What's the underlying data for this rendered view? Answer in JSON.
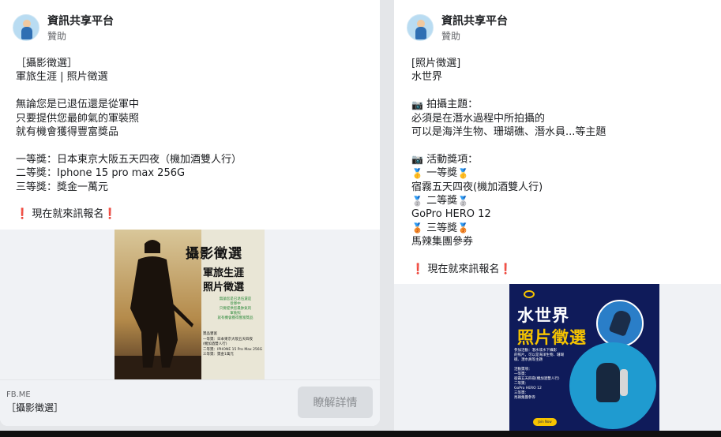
{
  "card1": {
    "page_name": "資訊共享平台",
    "sponsored": "贊助",
    "body": {
      "line1": "［攝影徵選］",
      "line2": "軍旅生涯 | 照片徵選",
      "line3": "無論您是已退伍還是從軍中",
      "line4": "只要提供您最帥氣的軍裝照",
      "line5": "就有機會獲得豐富獎品",
      "line6": "一等獎：日本東京大阪五天四夜（機加酒雙人行）",
      "line7": "二等獎：Iphone 15 pro max 256G",
      "line8": "三等獎：獎金一萬元",
      "line9": "現在就來訊報名"
    },
    "poster": {
      "title": "攝影徵選",
      "sub1": "軍旅生涯",
      "sub2": "照片徵選",
      "green_text": "無論您是已退伍還是\n從軍中\n只要提供您最帥氣的\n軍裝照\n就有機會獲得豐富獎品",
      "prize_text": "獎品豐富\n一等獎：日本東京大阪五天四夜\n(機加酒雙人行)\n二等獎：IPHONE 15 Pro Max 256G\n三等獎：獎金1萬元"
    },
    "link": {
      "domain": "FB.ME",
      "title": "［攝影徵選］",
      "button": "瞭解詳情"
    }
  },
  "card2": {
    "page_name": "資訊共享平台",
    "sponsored": "贊助",
    "body": {
      "line1": "[照片徵選]",
      "line2": "水世界",
      "line3": "拍攝主題：",
      "line4": "必須是在潛水過程中所拍攝的",
      "line5": "可以是海洋生物、珊瑚礁、潛水員...等主題",
      "line6": "活動獎項：",
      "line7": "一等獎",
      "line8": "宿霧五天四夜(機加酒雙人行)",
      "line9": "二等獎",
      "line10": "GoPro HERO 12",
      "line11": "三等獎",
      "line12": "馬辣集團參券",
      "line13": "現在就來訊報名"
    },
    "poster": {
      "title": "水世界",
      "title2": "照片徵選",
      "text": "參加活動：潛水或水下攝影\n的照片，可以是海洋生物、珊瑚\n礁、潛水員等主題\n\n活動獎項：\n一等獎：\n宿霧五天四夜(機加酒雙人行)\n二等獎：\nGoPro HERO 12\n三等獎：\n馬辣集團參券",
      "button": "Join Now"
    }
  }
}
